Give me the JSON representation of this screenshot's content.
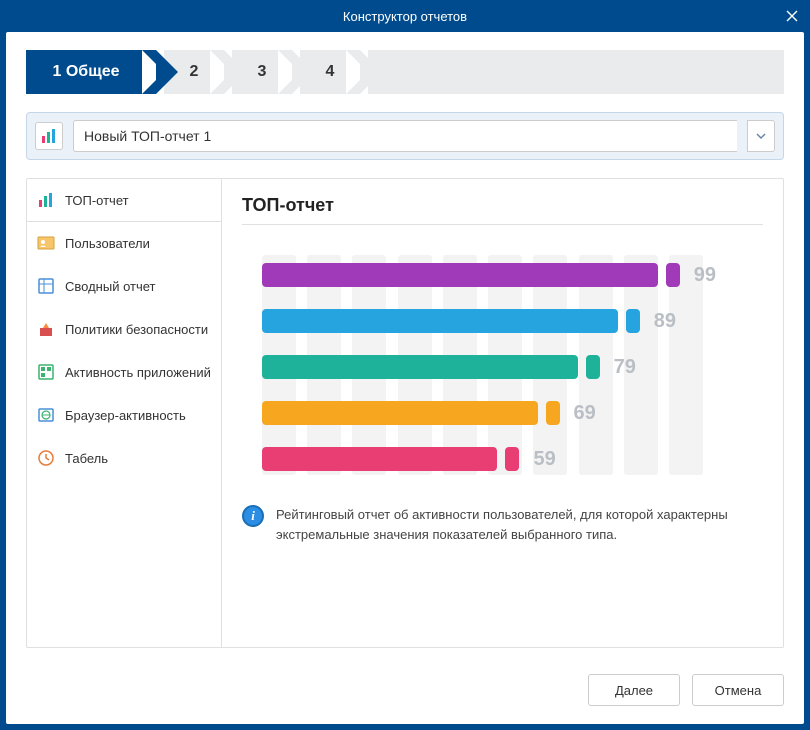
{
  "window": {
    "title": "Конструктор отчетов"
  },
  "stepper": {
    "active_step": 1,
    "active_label": "1 Общее",
    "steps": [
      "2",
      "3",
      "4"
    ]
  },
  "report_name": "Новый ТОП-отчет 1",
  "sidebar": {
    "items": [
      {
        "label": "ТОП-отчет",
        "icon": "bar-chart-icon",
        "active": true
      },
      {
        "label": "Пользователи",
        "icon": "users-icon"
      },
      {
        "label": "Сводный отчет",
        "icon": "summary-icon"
      },
      {
        "label": "Политики безопасности",
        "icon": "alert-icon"
      },
      {
        "label": "Активность приложений",
        "icon": "apps-icon"
      },
      {
        "label": "Браузер-активность",
        "icon": "browser-icon"
      },
      {
        "label": "Табель",
        "icon": "clock-icon"
      }
    ]
  },
  "preview": {
    "title": "ТОП-отчет",
    "description": "Рейтинговый отчет об активности пользователей, для которой характерны экстремальные значения показателей выбранного типа."
  },
  "chart_data": {
    "type": "bar",
    "orientation": "horizontal",
    "title": "ТОП-отчет",
    "xlabel": "",
    "ylabel": "",
    "xlim": [
      0,
      100
    ],
    "categories": [
      "",
      "",
      "",
      "",
      ""
    ],
    "series": [
      {
        "name": "",
        "values": [
          99,
          89,
          79,
          69,
          59
        ],
        "colors": [
          "#a13ab8",
          "#25a4e0",
          "#1fb29a",
          "#f7a61f",
          "#e83e73"
        ]
      }
    ]
  },
  "footer": {
    "next_label": "Далее",
    "cancel_label": "Отмена"
  }
}
